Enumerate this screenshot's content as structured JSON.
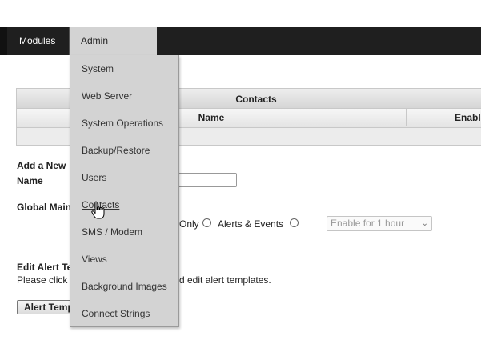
{
  "nav": {
    "modules": "Modules",
    "admin": "Admin"
  },
  "admin_menu": {
    "items": [
      "System",
      "Web Server",
      "System Operations",
      "Backup/Restore",
      "Users",
      "Contacts",
      "SMS / Modem",
      "Views",
      "Background Images",
      "Connect Strings"
    ],
    "hovered": "Contacts"
  },
  "contacts_table": {
    "title": "Contacts",
    "columns": [
      "Name",
      "Enabl"
    ]
  },
  "add_new": {
    "heading": "Add a New",
    "name_label": "Name",
    "name_value": ""
  },
  "global_maint": {
    "label": "Global Main",
    "option_only": "Only",
    "option_alerts_events": "Alerts & Events",
    "select_value": "Enable for 1 hour"
  },
  "edit_alert": {
    "heading": "Edit Alert Te",
    "instructions_left": "Please click",
    "instructions_right": "d edit alert templates.",
    "button_label": "Alert Temp"
  },
  "icons": {
    "cursor": "hand-pointer-icon",
    "select_arrow": "chevron-down-icon"
  }
}
